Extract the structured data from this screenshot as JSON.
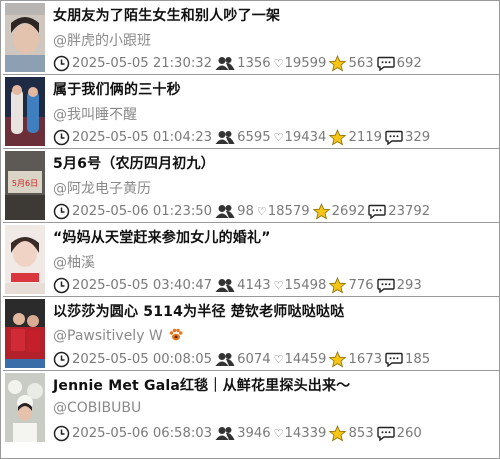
{
  "items": [
    {
      "title": "女朋友为了陌生女生和别人吵了一架",
      "author": "@胖虎的小跟班",
      "time": "2025-05-05 21:30:32",
      "plays": "1356",
      "likes": "19599",
      "favs": "563",
      "comments": "692"
    },
    {
      "title": "属于我们俩的三十秒",
      "author": "@我叫睡不醒",
      "time": "2025-05-05 01:04:23",
      "plays": "6595",
      "likes": "19434",
      "favs": "2119",
      "comments": "329"
    },
    {
      "title": "5月6号（农历四月初九）",
      "author": "@阿龙电子黄历",
      "time": "2025-05-06 01:23:50",
      "plays": "98",
      "likes": "18579",
      "favs": "2692",
      "comments": "23792",
      "thumb_text": "5月6日"
    },
    {
      "title": "“妈妈从天堂赶来参加女儿的婚礼”",
      "author": "@柚溪",
      "time": "2025-05-05 03:40:47",
      "plays": "4143",
      "likes": "15498",
      "favs": "776",
      "comments": "293"
    },
    {
      "title": "以莎莎为圆心 5114为半径 楚钦老师哒哒哒哒",
      "author": "@Pawsitively W",
      "time": "2025-05-05 00:08:05",
      "plays": "6074",
      "likes": "14459",
      "favs": "1673",
      "comments": "185"
    },
    {
      "title": "Jennie Met Gala红毯｜从鲜花里探头出来～",
      "author": "@COBIBUBU",
      "time": "2025-05-06 06:58:03",
      "plays": "3946",
      "likes": "14339",
      "favs": "853",
      "comments": "260"
    }
  ],
  "icons": {
    "clock": "clock-icon",
    "plays": "people-icon",
    "likes": "heart-icon",
    "favs": "star-icon",
    "comments": "comment-icon",
    "author_badge": "paw-icon"
  },
  "colors": {
    "star": "#f5c518",
    "text": "#111111",
    "muted": "#8a8a8a"
  },
  "heart_glyph": "♡"
}
